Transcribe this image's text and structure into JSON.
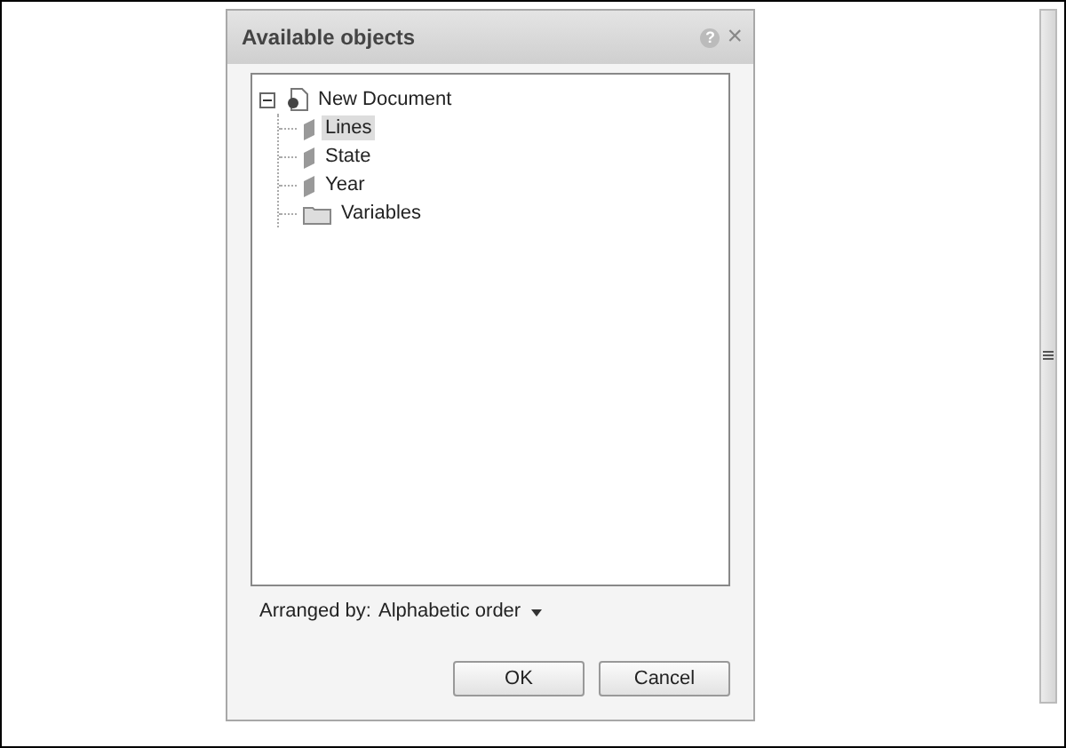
{
  "dialog": {
    "title": "Available objects",
    "help_icon": "?",
    "close_icon": "×"
  },
  "tree": [
    {
      "label": "New Document",
      "kind": "document",
      "expanded": true,
      "selected": false,
      "children": [
        {
          "label": "Lines",
          "kind": "object",
          "selected": true
        },
        {
          "label": "State",
          "kind": "object",
          "selected": false
        },
        {
          "label": "Year",
          "kind": "object",
          "selected": false
        },
        {
          "label": "Variables",
          "kind": "folder",
          "selected": false
        }
      ]
    }
  ],
  "arranged_by": {
    "label": "Arranged by:",
    "value": "Alphabetic order"
  },
  "buttons": [
    "OK",
    "Cancel"
  ]
}
